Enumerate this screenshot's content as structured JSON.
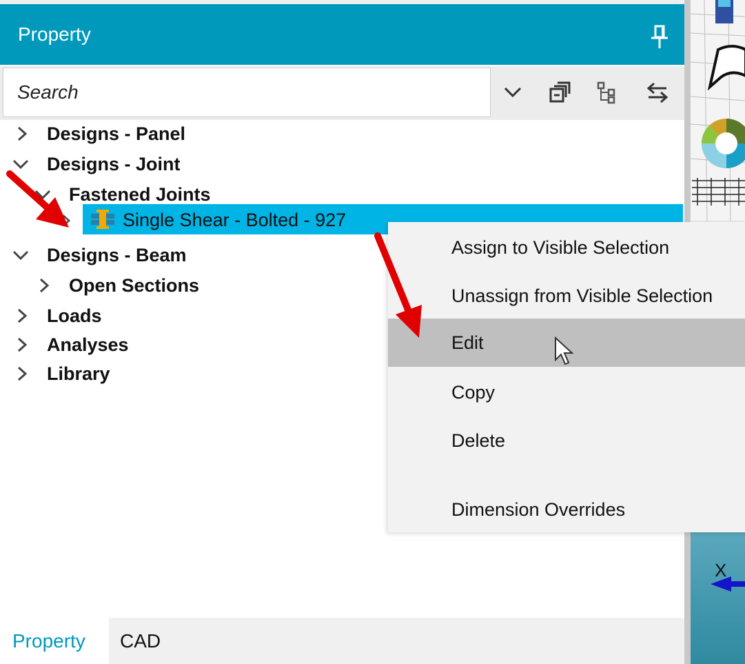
{
  "panel": {
    "title": "Property",
    "search_placeholder": "Search"
  },
  "tree": {
    "designs_panel": "Designs - Panel",
    "designs_joint": "Designs - Joint",
    "fastened_joints": "Fastened Joints",
    "selected_item": "Single Shear - Bolted - 927",
    "designs_beam": "Designs - Beam",
    "open_sections": "Open Sections",
    "loads": "Loads",
    "analyses": "Analyses",
    "library": "Library"
  },
  "context_menu": {
    "items": [
      "Assign to Visible Selection",
      "Unassign from Visible Selection",
      "Edit",
      "Copy",
      "Delete",
      "Dimension Overrides"
    ],
    "highlighted": "Edit"
  },
  "tabs": [
    "Property",
    "CAD"
  ],
  "active_tab": "Property",
  "viewport": {
    "axis_label": "X"
  },
  "colors": {
    "accent": "#0099bc",
    "selection": "#00b4e6",
    "menu_hover": "#bfbfbf",
    "annotation_arrow": "#e00000"
  },
  "icons": {
    "pin": "pin-icon",
    "dropdown": "chevron-down-icon",
    "collapse_all": "collapse-all-icon",
    "tree_view": "tree-view-icon",
    "sync": "sync-arrows-icon",
    "joint": "bolted-joint-icon"
  }
}
